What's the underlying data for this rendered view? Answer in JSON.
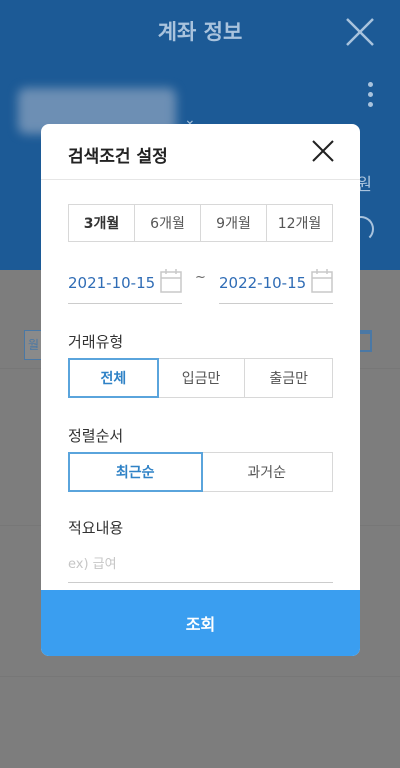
{
  "background": {
    "title": "계좌 정보",
    "currency_suffix": "원",
    "chip_left": "월"
  },
  "modal": {
    "title": "검색조건 설정",
    "period_options": [
      "3개월",
      "6개월",
      "9개월",
      "12개월"
    ],
    "period_selected": "3개월",
    "date_start": "2021-10-15",
    "date_separator": "~",
    "date_end": "2022-10-15",
    "transaction_type": {
      "label": "거래유형",
      "options": [
        "전체",
        "입금만",
        "출금만"
      ],
      "selected": "전체"
    },
    "sort_order": {
      "label": "정렬순서",
      "options": [
        "최근순",
        "과거순"
      ],
      "selected": "최근순"
    },
    "memo": {
      "label": "적요내용",
      "placeholder": "ex) 급여",
      "value": ""
    },
    "submit_label": "조회"
  },
  "colors": {
    "accent": "#3a9ef0",
    "date_text": "#2f6cb5",
    "selected_border": "#5aa4dc",
    "overlay_header": "#1c5a96"
  }
}
